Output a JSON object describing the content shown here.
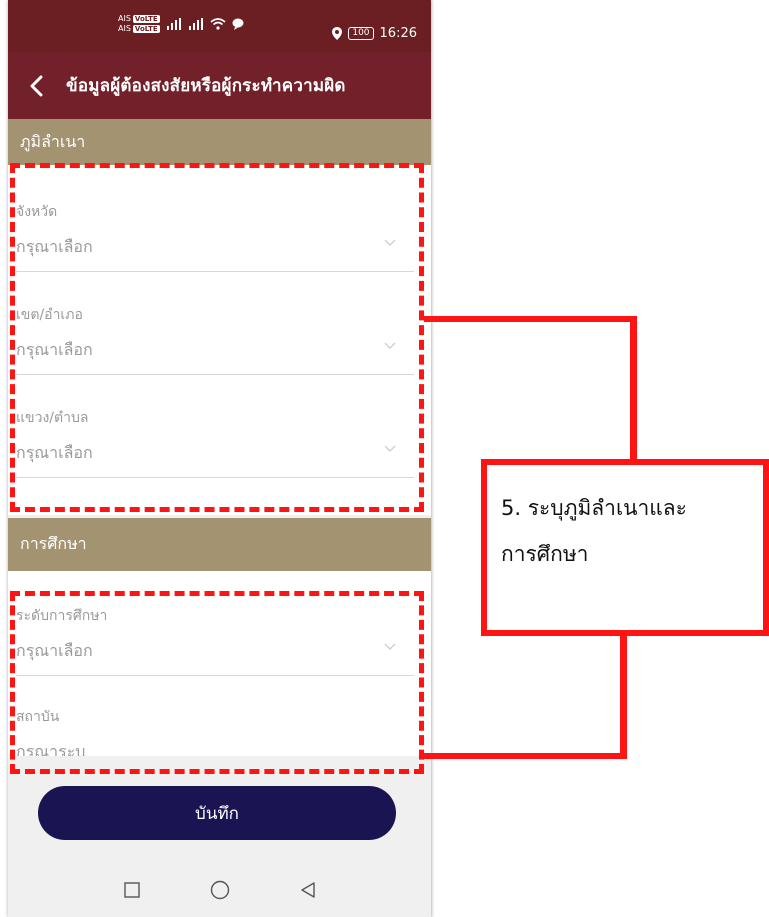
{
  "status_bar": {
    "carrier_1": "AIS",
    "carrier_2": "AIS",
    "badge": "VoLTE",
    "battery": "100",
    "time": "16:26"
  },
  "app_bar": {
    "title": "ข้อมูลผู้ต้องสงสัยหรือผู้กระทำความผิด"
  },
  "domicile": {
    "header": "ภูมิลำเนา",
    "fields": [
      {
        "label": "จังหวัด",
        "value": "กรุณาเลือก"
      },
      {
        "label": "เขต/อำเภอ",
        "value": "กรุณาเลือก"
      },
      {
        "label": "แขวง/ตำบล",
        "value": "กรุณาเลือก"
      }
    ]
  },
  "education": {
    "header": "การศึกษา",
    "fields": [
      {
        "label": "ระดับการศึกษา",
        "value": "กรุณาเลือก"
      },
      {
        "label": "สถาบัน",
        "placeholder": "กรุณาระบุ"
      }
    ]
  },
  "save_label": "บันทึก",
  "annotation": {
    "line1": "5. ระบุภูมิลำเนาและ",
    "line2": "การศึกษา"
  },
  "colors": {
    "status_bar": "#6b1f23",
    "app_bar": "#72202a",
    "section_header": "#a39371",
    "save_button": "#1b1453",
    "annotation": "#ff1414"
  }
}
